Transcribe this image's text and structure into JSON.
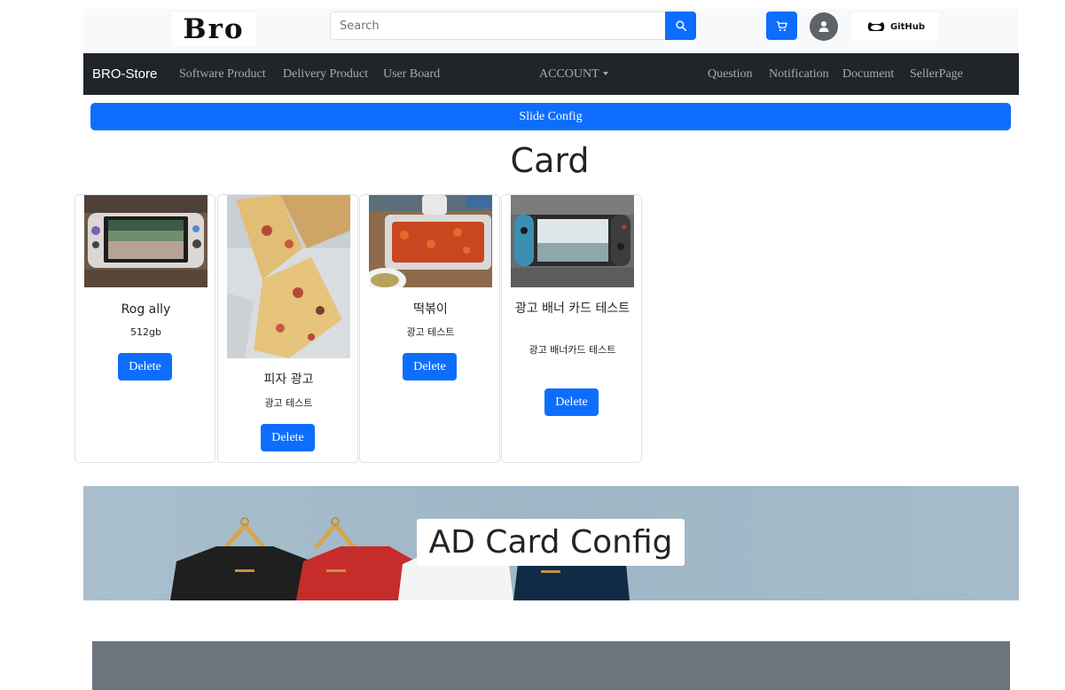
{
  "header": {
    "logo_text": "Bro",
    "search": {
      "placeholder": "Search",
      "value": ""
    },
    "icons": {
      "search": "search-icon",
      "cart": "cart-icon",
      "avatar": "user-avatar-icon",
      "github": "github-icon"
    },
    "github_label": "GitHub"
  },
  "navbar": {
    "brand": "BRO-Store",
    "left_links": [
      "Software Product",
      "Delivery Product",
      "User Board"
    ],
    "account_label": "ACCOUNT",
    "right_links": [
      "Question",
      "Notification",
      "Document",
      "SellerPage"
    ]
  },
  "slide_config_label": "Slide Config",
  "card_section": {
    "title": "Card",
    "cards": [
      {
        "title": "Rog ally",
        "text": "512gb",
        "button": "Delete",
        "image": "handheld-console-photo"
      },
      {
        "title": "피자 광고",
        "text": "광고 테스트",
        "button": "Delete",
        "image": "pizza-photo"
      },
      {
        "title": "떡볶이",
        "text": "광고 테스트",
        "button": "Delete",
        "image": "tteokbokki-photo"
      },
      {
        "title": "광고 배너 카드 테스트",
        "text": "광고 배너카드 테스트",
        "button": "Delete",
        "image": "switch-console-photo"
      }
    ]
  },
  "ad_section": {
    "title": "AD Card Config",
    "image": "tshirts-on-hangers-photo"
  },
  "colors": {
    "primary": "#0d6efd",
    "navbar": "#212529",
    "header_bg": "#f8f9fa",
    "footer": "#6c757d"
  }
}
